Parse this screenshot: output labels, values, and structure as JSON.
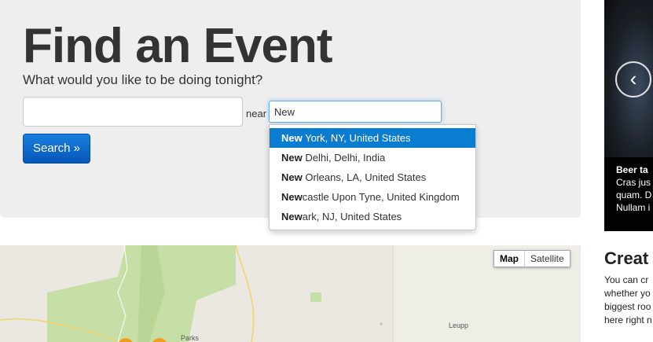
{
  "hero": {
    "title": "Find an Event",
    "subtitle": "What would you like to be doing tonight?",
    "what_value": "",
    "near_label": "near",
    "where_value": "New",
    "search_label": "Search »"
  },
  "suggestions": [
    {
      "match": "New",
      "rest": " York, NY, United States",
      "active": true
    },
    {
      "match": "New",
      "rest": " Delhi, Delhi, India"
    },
    {
      "match": "New",
      "rest": " Orleans, LA, United States"
    },
    {
      "match": "New",
      "rest": "castle Upon Tyne, United Kingdom"
    },
    {
      "match": "New",
      "rest": "ark, NJ, United States"
    }
  ],
  "map": {
    "type_map": "Map",
    "type_satellite": "Satellite",
    "labels": [
      "Parks",
      "Leupp"
    ]
  },
  "carousel": {
    "prev_icon": "‹",
    "caption_title": "Beer ta",
    "caption_lines": [
      "Cras jus",
      "quam. D",
      "Nullam i"
    ]
  },
  "create": {
    "title": "Creat",
    "lines": [
      "You can cr",
      "whether yo",
      "biggest roo",
      "here right n"
    ]
  },
  "colors": {
    "primary": "#0a7dd1",
    "hero_bg": "#eeeeee",
    "map_land": "#ebe8e1",
    "map_park": "#c6dfa7"
  }
}
